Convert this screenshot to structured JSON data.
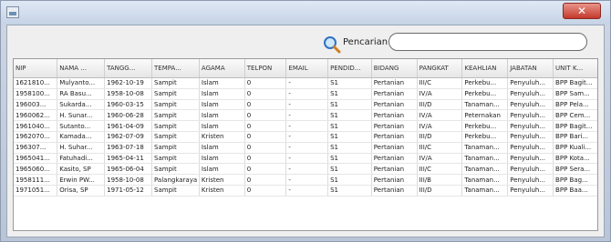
{
  "window": {
    "close_label": "✕"
  },
  "search": {
    "label": "Pencarian :",
    "value": "",
    "placeholder": ""
  },
  "table": {
    "columns": [
      "NIP",
      "NAMA ...",
      "TANGG...",
      "TEMPA...",
      "AGAMA",
      "TELPON",
      "EMAIL",
      "PENDID...",
      "BIDANG",
      "PANGKAT",
      "KEAHLIAN",
      "JABATAN",
      "UNIT K..."
    ],
    "rows": [
      [
        "1621810...",
        "Mulyanto...",
        "1962-10-19",
        "Sampit",
        "Islam",
        "0",
        "-",
        "S1",
        "Pertanian",
        "III/C",
        "Perkebu...",
        "Penyuluh...",
        "BPP Bagit..."
      ],
      [
        "1958100...",
        "RA Basu...",
        "1958-10-08",
        "Sampit",
        "Islam",
        "0",
        "-",
        "S1",
        "Pertanian",
        "IV/A",
        "Perkebu...",
        "Penyuluh...",
        "BPP Sam..."
      ],
      [
        "196003...",
        "Sukarda...",
        "1960-03-15",
        "Sampit",
        "Islam",
        "0",
        "-",
        "S1",
        "Pertanian",
        "III/D",
        "Tanaman...",
        "Penyuluh...",
        "BPP Pela..."
      ],
      [
        "1960062...",
        "H. Sunar...",
        "1960-06-28",
        "Sampit",
        "Islam",
        "0",
        "-",
        "S1",
        "Pertanian",
        "IV/A",
        "Peternakan",
        "Penyuluh...",
        "BPP Cem..."
      ],
      [
        "1961040...",
        "Sutanto...",
        "1961-04-09",
        "Sampit",
        "Islam",
        "0",
        "-",
        "S1",
        "Pertanian",
        "IV/A",
        "Perkebu...",
        "Penyuluh...",
        "BPP Bagit..."
      ],
      [
        "1962070...",
        "Kamada...",
        "1962-07-09",
        "Sampit",
        "Kristen",
        "0",
        "-",
        "S1",
        "Pertanian",
        "III/D",
        "Perkebu...",
        "Penyuluh...",
        "BPP Bari..."
      ],
      [
        "196307...",
        "H. Suhar...",
        "1963-07-18",
        "Sampit",
        "Islam",
        "0",
        "-",
        "S1",
        "Pertanian",
        "III/C",
        "Tanaman...",
        "Penyuluh...",
        "BPP Kuali..."
      ],
      [
        "1965041...",
        "Fatuhadi...",
        "1965-04-11",
        "Sampit",
        "Islam",
        "0",
        "-",
        "S1",
        "Pertanian",
        "IV/A",
        "Tanaman...",
        "Penyuluh...",
        "BPP Kota..."
      ],
      [
        "1965060...",
        "Kasito, SP",
        "1965-06-04",
        "Sampit",
        "Islam",
        "0",
        "-",
        "S1",
        "Pertanian",
        "III/C",
        "Tanaman...",
        "Penyuluh...",
        "BPP Sera..."
      ],
      [
        "1958111...",
        "Erwin PW...",
        "1958-10-08",
        "Palangkaraya",
        "Kristen",
        "0",
        "-",
        "S1",
        "Pertanian",
        "III/B",
        "Tanaman...",
        "Penyuluh...",
        "BPP Bag..."
      ],
      [
        "1971051...",
        "Orisa, SP",
        "1971-05-12",
        "Sampit",
        "Kristen",
        "0",
        "-",
        "S1",
        "Pertanian",
        "III/D",
        "Tanaman...",
        "Penyuluh...",
        "BPP Baa..."
      ]
    ]
  }
}
